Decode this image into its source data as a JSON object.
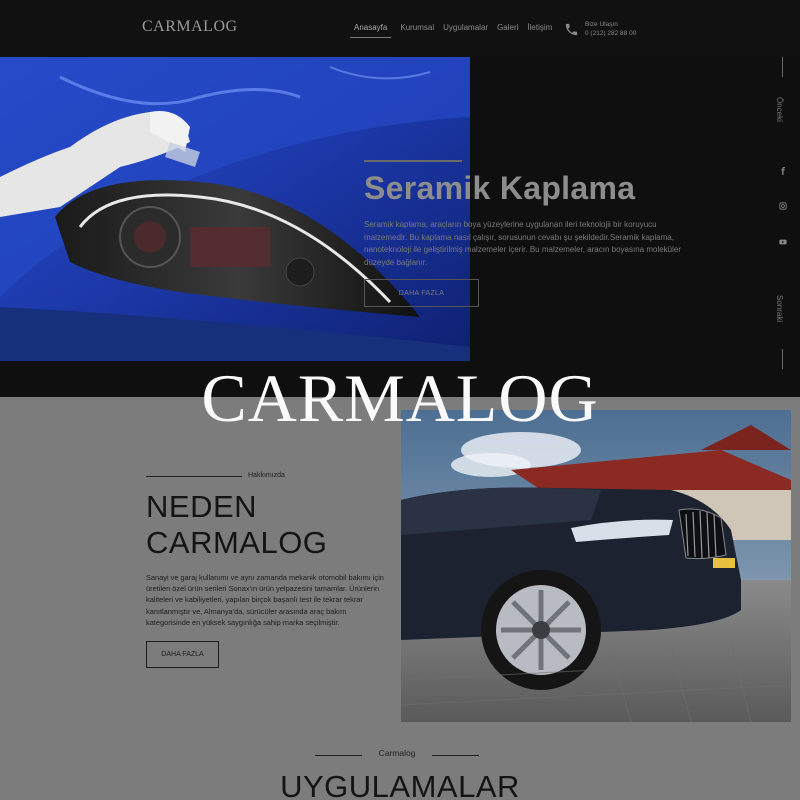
{
  "header": {
    "logo": "CARMALOG",
    "nav": [
      "Anasayfa",
      "Kurumsal",
      "Uygulamalar",
      "Galeri",
      "İletişim"
    ],
    "contact_label": "Bize Ulaşın",
    "contact_phone": "0 (212) 282 88 00",
    "contact_icon": "phone-icon"
  },
  "hero": {
    "title": "Seramik Kaplama",
    "description": "Seramik kaplama, araçların boya yüzeylerine uygulanan ileri teknolojii bir koruyucu malzemedir. Bu kaplama nasıl çalışır, sorusunun cevabı şu şekildedir.Seramik kaplama, nanoteknoloji ile geliştirilmiş malzemeler içerir. Bu malzemeler, aracın boyasına moleküler düzeyde bağlanır.",
    "button": "DAHA FAZLA",
    "prev": "Önceki",
    "next": "Sonraki",
    "social_icons": [
      "facebook-icon",
      "instagram-icon",
      "youtube-icon"
    ]
  },
  "overlay_logo": "CARMALOG",
  "about": {
    "label": "Hakkımızda",
    "title_line1": "NEDEN",
    "title_line2": "CARMALOG",
    "description": "Sanayi ve garaj kullanımı ve aynı zamanda mekanik otomobil bakımı için üretilen özel ürün serileri Sonax'ın ürün yelpazesini tamamlar. Ürünlerin kaliteleri ve kabiliyetleri, yapılan birçok başarılı test ile tekrar tekrar kanıtlanmıştır ve, Almanya'da, sürücüler arasında araç bakım kategorisinde en yüksek saygınlığa sahip marka seçilmiştir.",
    "button": "DAHA FAZLA"
  },
  "applications": {
    "label": "Carmalog",
    "title": "UYGULAMALAR"
  },
  "colors": {
    "background_dark": "#0f0f0f",
    "about_bg": "#7c7c7c",
    "car_blue": "#1f3fb8"
  }
}
